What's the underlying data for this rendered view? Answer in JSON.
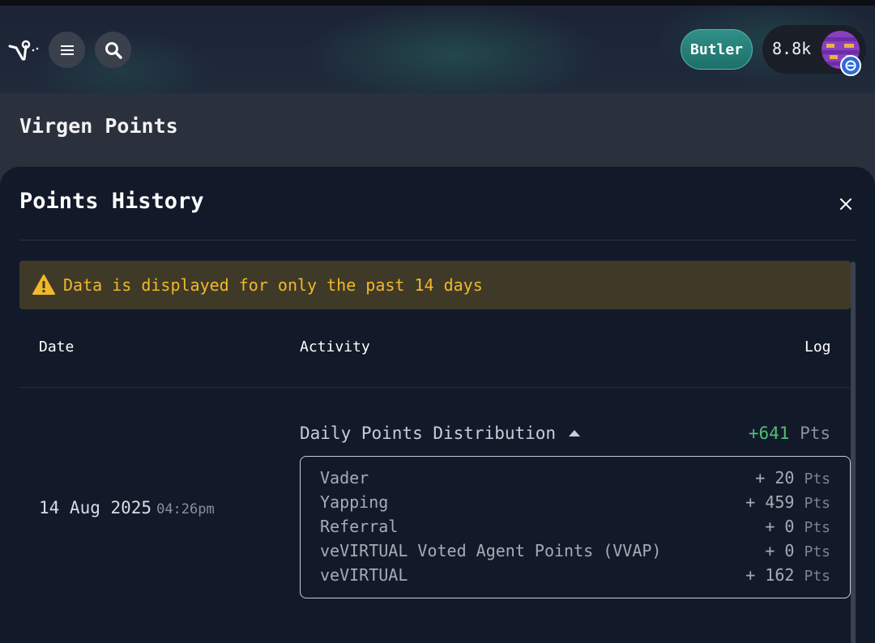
{
  "header": {
    "butler_label": "Butler",
    "points_count": "8.8k"
  },
  "page": {
    "title": "Virgen Points"
  },
  "panel": {
    "title": "Points History",
    "warning": "Data is displayed for only the past 14 days",
    "columns": {
      "date": "Date",
      "activity": "Activity",
      "log": "Log"
    },
    "entries": [
      {
        "date": "14 Aug 2025",
        "time": "04:26pm",
        "activity": "Daily Points Distribution",
        "total": "+641",
        "unit": "Pts",
        "breakdown": [
          {
            "label": "Vader",
            "value": "+ 20",
            "unit": "Pts"
          },
          {
            "label": "Yapping",
            "value": "+ 459",
            "unit": "Pts"
          },
          {
            "label": "Referral",
            "value": "+ 0",
            "unit": "Pts"
          },
          {
            "label": "veVIRTUAL Voted Agent Points (VVAP)",
            "value": "+ 0",
            "unit": "Pts"
          },
          {
            "label": "veVIRTUAL",
            "value": "+ 162",
            "unit": "Pts"
          }
        ]
      }
    ]
  },
  "icons": {
    "logo": "virgen-logo-icon",
    "menu": "hamburger-menu-icon",
    "search": "search-icon",
    "close": "close-icon",
    "warning": "warning-triangle-icon",
    "expand": "caret-up-icon"
  },
  "colors": {
    "accent_teal": "#2f9088",
    "positive": "#4fbf72",
    "warning": "#f1b82a"
  }
}
